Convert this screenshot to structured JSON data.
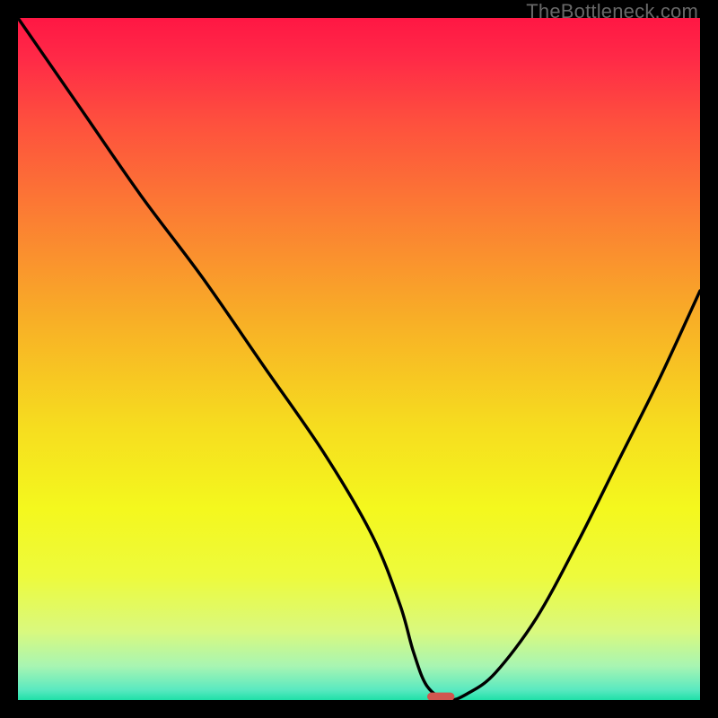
{
  "watermark": "TheBottleneck.com",
  "chart_data": {
    "type": "line",
    "title": "",
    "xlabel": "",
    "ylabel": "",
    "xlim": [
      0,
      100
    ],
    "ylim": [
      0,
      100
    ],
    "series": [
      {
        "name": "curve",
        "x": [
          0,
          9,
          18,
          27,
          36,
          45,
          52,
          56,
          58,
          60,
          63,
          66,
          70,
          76,
          82,
          88,
          94,
          100
        ],
        "values": [
          100,
          87,
          74,
          62,
          49,
          36,
          24,
          14,
          7,
          2,
          0,
          1,
          4,
          12,
          23,
          35,
          47,
          60
        ]
      }
    ],
    "marker": {
      "x": 62,
      "y": 0.5,
      "w": 4,
      "h": 1.2,
      "rx": 0.6
    },
    "gradient_stops": [
      {
        "offset": 0.0,
        "color": "#ff1744"
      },
      {
        "offset": 0.06,
        "color": "#ff2a47"
      },
      {
        "offset": 0.15,
        "color": "#fe4f3e"
      },
      {
        "offset": 0.3,
        "color": "#fb8132"
      },
      {
        "offset": 0.45,
        "color": "#f8b126"
      },
      {
        "offset": 0.6,
        "color": "#f6dd1f"
      },
      {
        "offset": 0.72,
        "color": "#f4f81e"
      },
      {
        "offset": 0.82,
        "color": "#edfa3d"
      },
      {
        "offset": 0.9,
        "color": "#d9f97f"
      },
      {
        "offset": 0.95,
        "color": "#a8f5b2"
      },
      {
        "offset": 0.985,
        "color": "#5ae9c0"
      },
      {
        "offset": 1.0,
        "color": "#1fe0a8"
      }
    ]
  }
}
